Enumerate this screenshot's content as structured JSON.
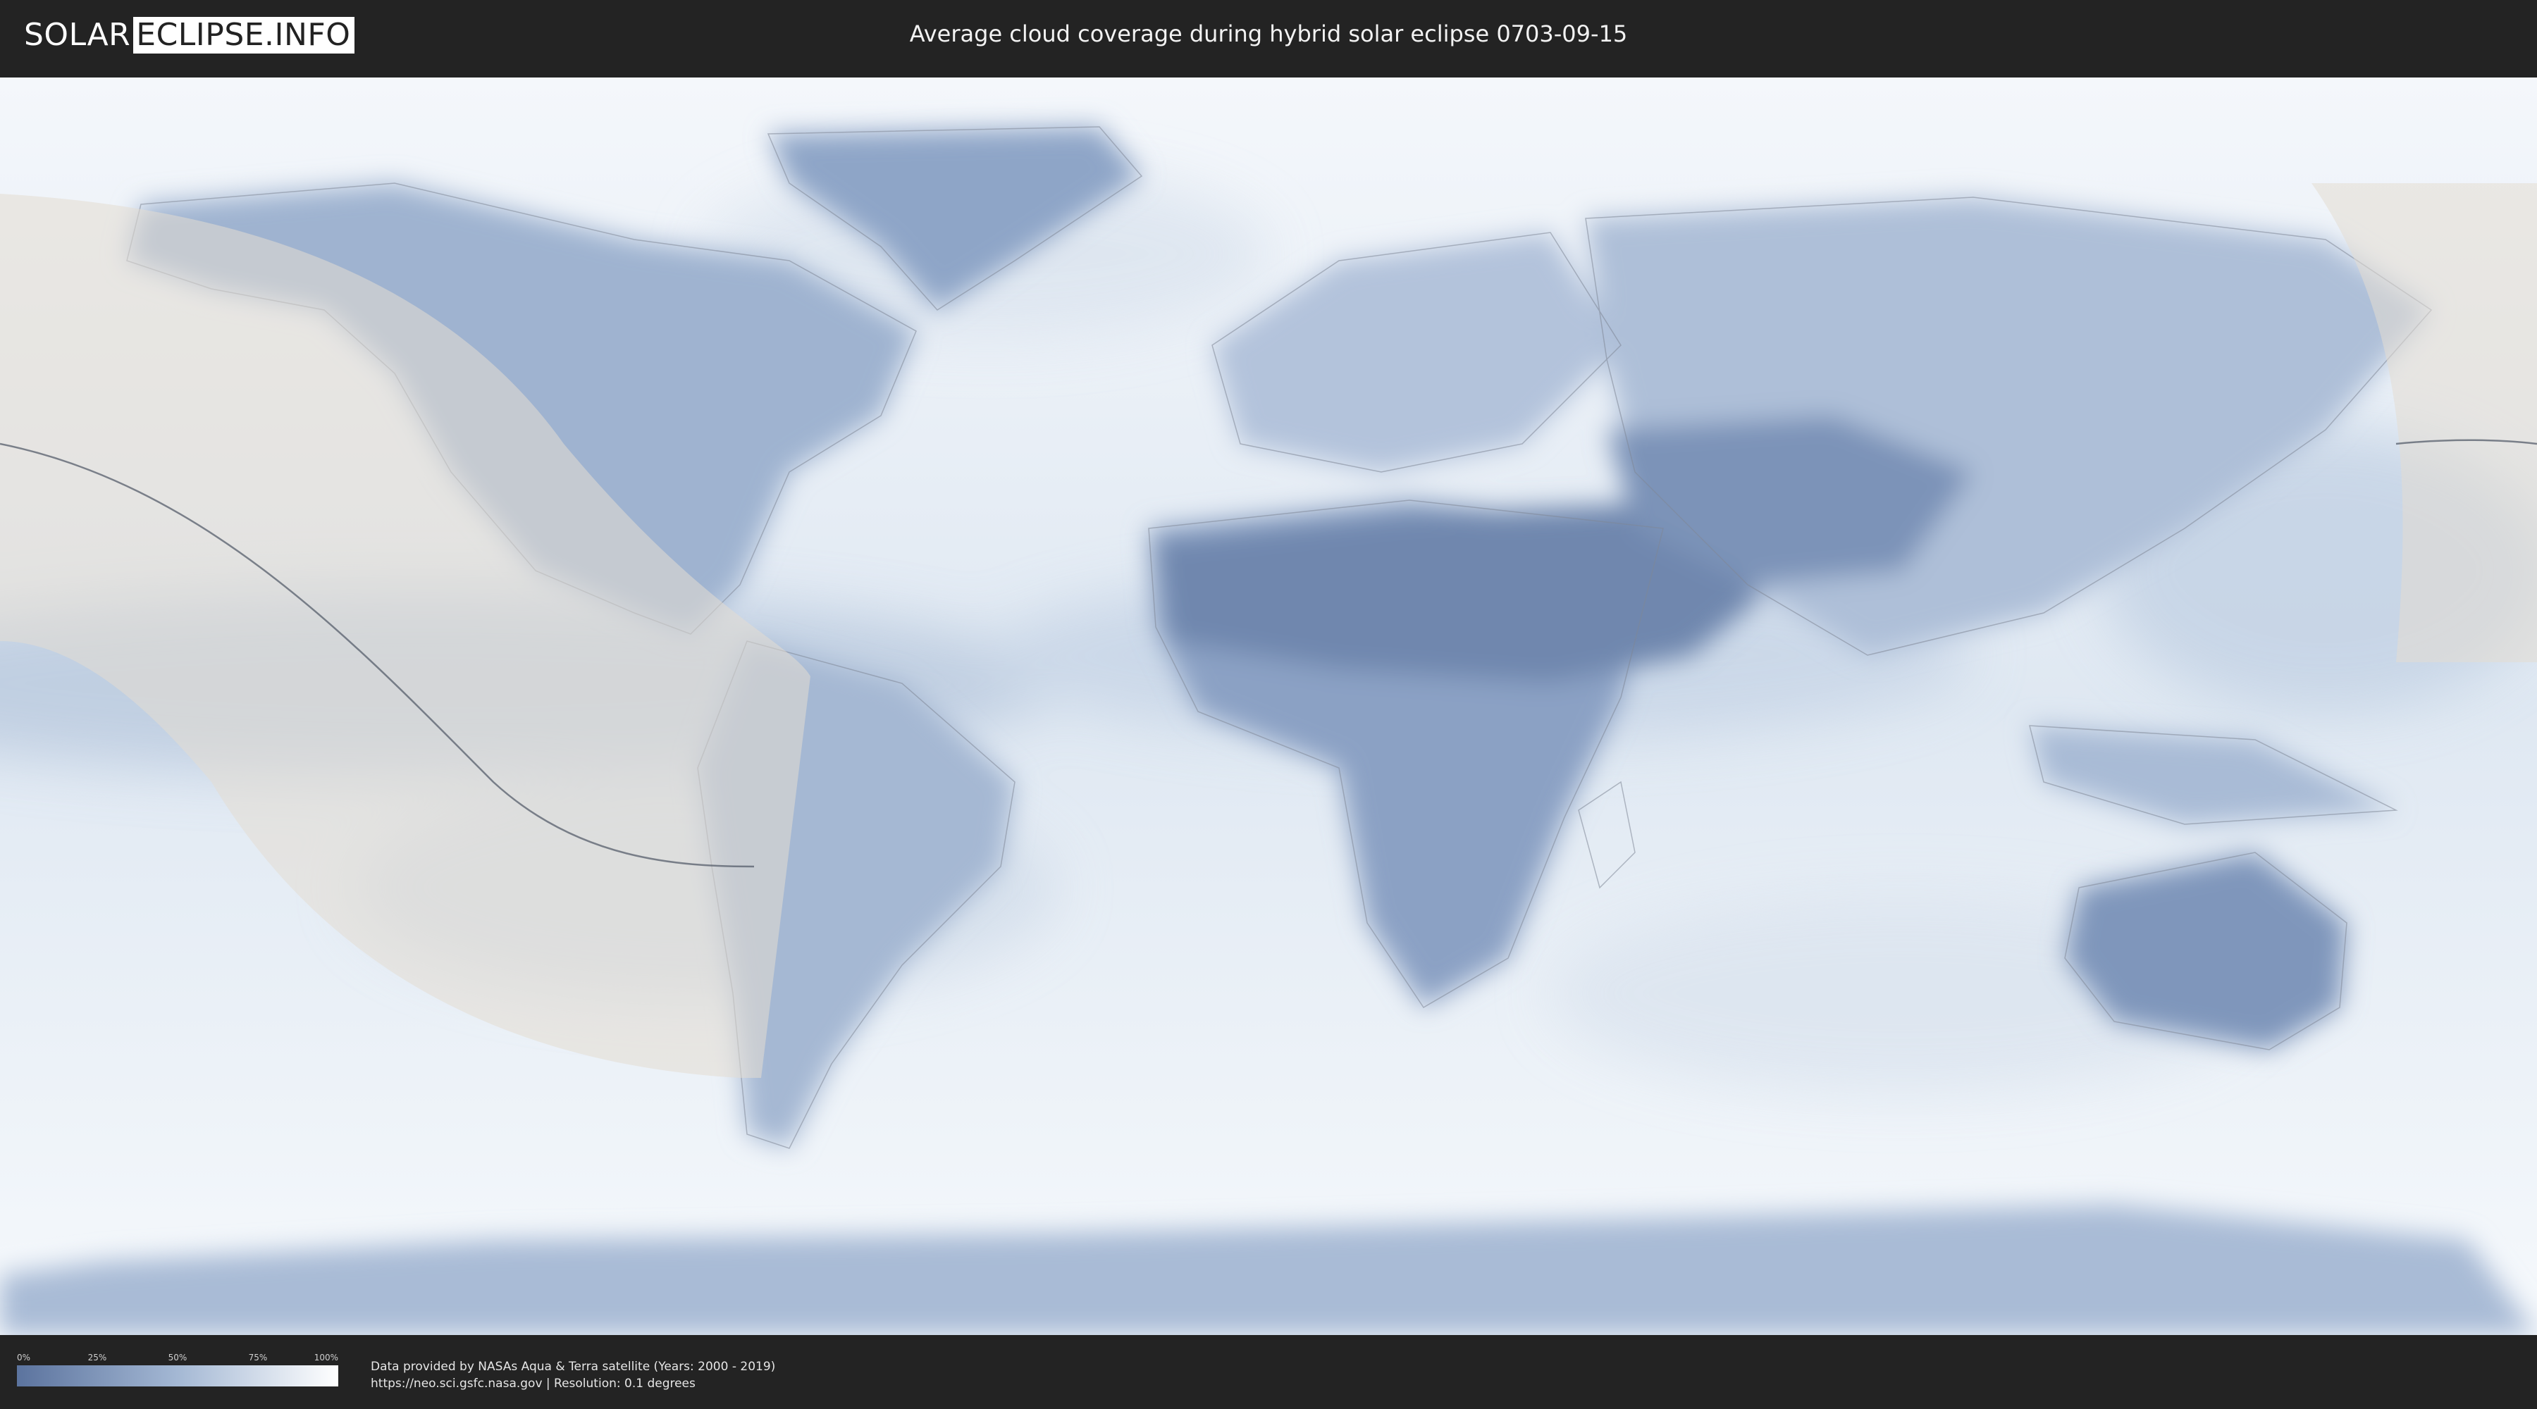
{
  "header": {
    "logo_left": "SOLAR",
    "logo_right": "ECLIPSE.INFO",
    "title": "Average cloud coverage during hybrid solar eclipse 0703-09-15"
  },
  "map": {
    "colors": {
      "ocean_clear": "#e9eff6",
      "cloud_low": "#5b739e",
      "cloud_high": "#ffffff",
      "eclipse_overlay": "#e4dcd2",
      "borders": "#7f8796"
    }
  },
  "legend": {
    "ticks": [
      "0%",
      "25%",
      "50%",
      "75%",
      "100%"
    ],
    "gradient": [
      "#5b739e",
      "#a4b8d4",
      "#ffffff"
    ]
  },
  "footer": {
    "credit_line1": "Data provided by NASAs Aqua & Terra satellite (Years: 2000 - 2019)",
    "credit_line2": "https://neo.sci.gsfc.nasa.gov | Resolution: 0.1 degrees"
  }
}
